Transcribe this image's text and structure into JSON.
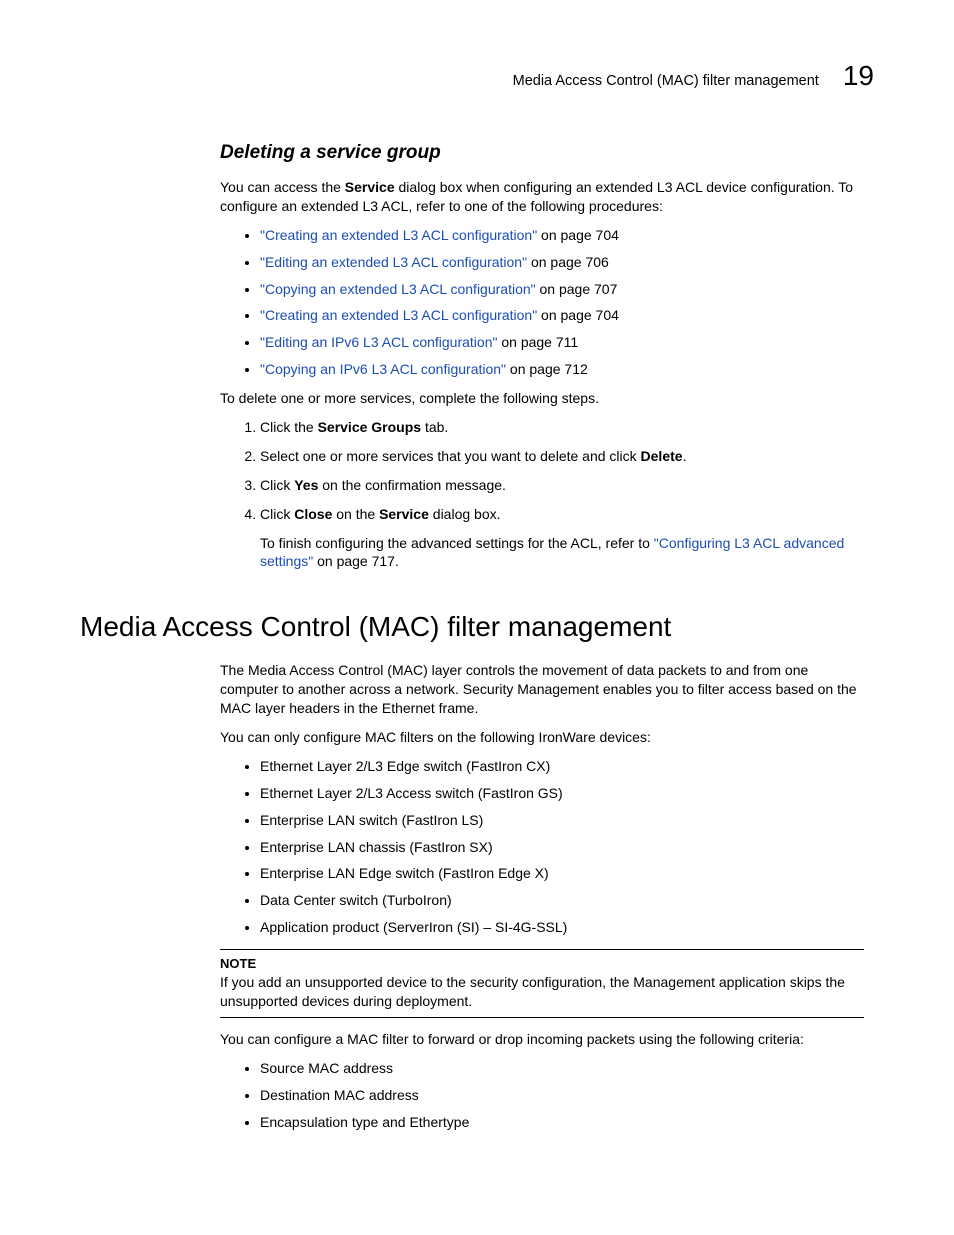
{
  "header": {
    "title": "Media Access Control (MAC) filter management",
    "chapter": "19"
  },
  "sec1": {
    "heading": "Deleting a service group",
    "intro1a": "You can access the ",
    "intro1b": "Service",
    "intro1c": " dialog box when configuring an extended L3 ACL device configuration. To configure an extended L3 ACL, refer to one of the following procedures:",
    "links": [
      {
        "text": "\"Creating an extended L3 ACL configuration\"",
        "tail": " on page 704"
      },
      {
        "text": "\"Editing an extended L3 ACL configuration\"",
        "tail": " on page 706"
      },
      {
        "text": "\"Copying an extended L3 ACL configuration\"",
        "tail": " on page 707"
      },
      {
        "text": "\"Creating an extended L3 ACL configuration\"",
        "tail": " on page 704"
      },
      {
        "text": "\"Editing an IPv6 L3 ACL configuration\"",
        "tail": " on page 711"
      },
      {
        "text": "\"Copying an IPv6 L3 ACL configuration\"",
        "tail": " on page 712"
      }
    ],
    "intro2": "To delete one or more services, complete the following steps.",
    "step1a": "Click the ",
    "step1b": "Service Groups",
    "step1c": " tab.",
    "step2a": "Select one or more services that you want to delete and click ",
    "step2b": "Delete",
    "step2c": ".",
    "step3a": "Click ",
    "step3b": "Yes",
    "step3c": " on the confirmation message.",
    "step4a": "Click ",
    "step4b": "Close",
    "step4c": " on the ",
    "step4d": "Service",
    "step4e": " dialog box.",
    "step4sub1": "To finish configuring the advanced settings for the ACL, refer to ",
    "step4sub_link": "\"Configuring L3 ACL advanced settings\"",
    "step4sub2": " on page 717."
  },
  "sec2": {
    "heading": "Media Access Control (MAC) filter management",
    "para1": "The Media Access Control (MAC) layer controls the movement of data packets to and from one computer to another across a network. Security Management enables you to filter access based on the MAC layer headers in the Ethernet frame.",
    "para2": "You can only configure MAC filters on the following IronWare devices:",
    "devices": [
      "Ethernet Layer 2/L3 Edge switch (FastIron CX)",
      "Ethernet Layer 2/L3 Access switch (FastIron GS)",
      "Enterprise LAN switch (FastIron LS)",
      "Enterprise LAN chassis (FastIron SX)",
      "Enterprise LAN Edge switch (FastIron Edge X)",
      "Data Center switch (TurboIron)",
      "Application product (ServerIron (SI) – SI-4G-SSL)"
    ],
    "note_title": "NOTE",
    "note_body": "If you add an unsupported device to the security configuration, the Management application skips the unsupported devices during deployment.",
    "para3": "You can configure a MAC filter to forward or drop incoming packets using the following criteria:",
    "criteria": [
      "Source MAC address",
      "Destination MAC address",
      "Encapsulation type and Ethertype"
    ]
  }
}
